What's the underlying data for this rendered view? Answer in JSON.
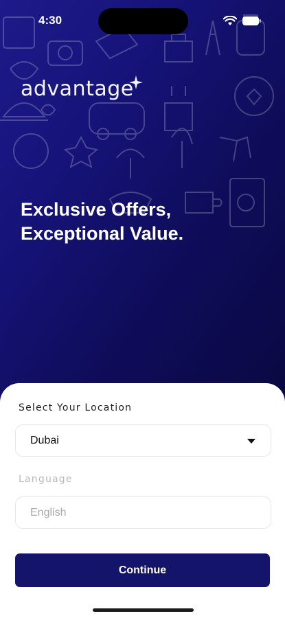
{
  "status_bar": {
    "time": "4:30",
    "icons": [
      "wifi-icon",
      "battery-icon"
    ]
  },
  "brand": {
    "logo_text": "advantage",
    "colors": {
      "hero_gradient_start": "#1d1b8a",
      "hero_gradient_end": "#0a0840",
      "button": "#15146b"
    }
  },
  "hero": {
    "headline_line1": "Exclusive Offers,",
    "headline_line2": "Exceptional Value."
  },
  "form": {
    "location_label": "Select Your Location",
    "location_value": "Dubai",
    "language_label": "Language",
    "language_value": "English",
    "continue_label": "Continue"
  }
}
